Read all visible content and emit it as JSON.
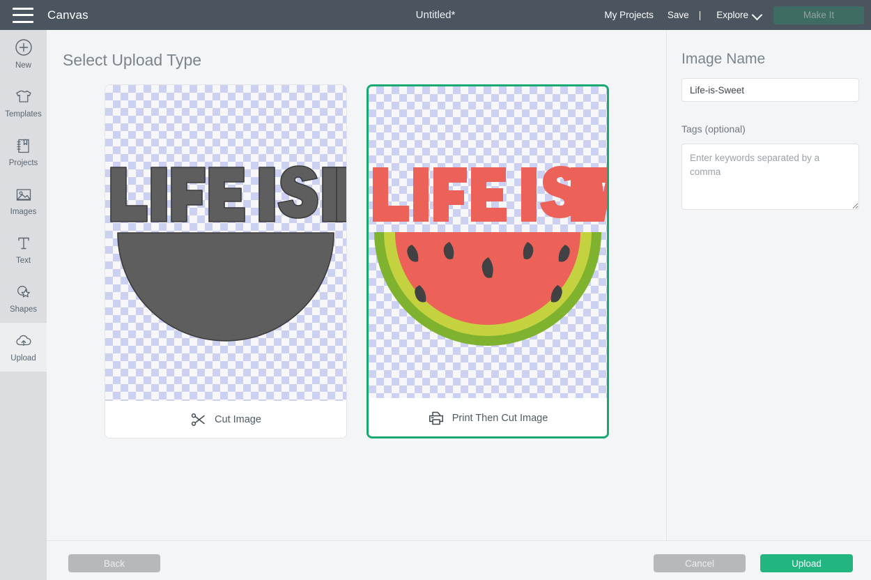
{
  "topbar": {
    "menu_icon": "hamburger-icon",
    "canvas_label": "Canvas",
    "document_title": "Untitled*",
    "my_projects_label": "My Projects",
    "save_label": "Save",
    "separator": "|",
    "explore_label": "Explore",
    "explore_chevron_icon": "chevron-down-icon",
    "make_it_label": "Make It",
    "make_it_disabled": true,
    "bg_color": "#4a5560",
    "make_it_color": "#3f6c62"
  },
  "sidebar": {
    "items": [
      {
        "label": "New",
        "icon": "plus-circle-icon",
        "active": false
      },
      {
        "label": "Templates",
        "icon": "tshirt-icon",
        "active": false
      },
      {
        "label": "Projects",
        "icon": "notebook-icon",
        "active": false
      },
      {
        "label": "Images",
        "icon": "picture-icon",
        "active": false
      },
      {
        "label": "Text",
        "icon": "text-t-icon",
        "active": false
      },
      {
        "label": "Shapes",
        "icon": "shapes-star-icon",
        "active": false
      },
      {
        "label": "Upload",
        "icon": "upload-cloud-icon",
        "active": true
      }
    ]
  },
  "main": {
    "title": "Select Upload Type",
    "cards": [
      {
        "id": "cut",
        "footer_label": "Cut Image",
        "footer_icon": "scissors-icon",
        "selected": false,
        "artwork": {
          "headline": "LIFE IS SWEET",
          "style": "silhouette",
          "fill_color": "#5e5e5e",
          "outline_color": "#3b3b3b"
        }
      },
      {
        "id": "print-then-cut",
        "footer_label": "Print Then Cut Image",
        "footer_icon": "printer-icon",
        "selected": true,
        "artwork": {
          "headline": "LIFE IS SWEET",
          "style": "full-color",
          "text_color": "#ec6258",
          "flesh_color": "#ec6258",
          "inner_rind_color": "#c5d23f",
          "outer_rind_color": "#7fb22f",
          "seed_color": "#414042"
        }
      }
    ],
    "selected_card_border_color": "#18a870",
    "checker_color_a": "#f7f7fa",
    "checker_color_b": "#ccd1f2"
  },
  "right_panel": {
    "image_name_label": "Image Name",
    "image_name_value": "Life-is-Sweet",
    "tags_label": "Tags (optional)",
    "tags_value": "",
    "tags_placeholder": "Enter keywords separated by a comma"
  },
  "footer": {
    "back_label": "Back",
    "back_disabled": true,
    "cancel_label": "Cancel",
    "cancel_disabled": true,
    "upload_label": "Upload",
    "upload_color": "#23b57f"
  }
}
